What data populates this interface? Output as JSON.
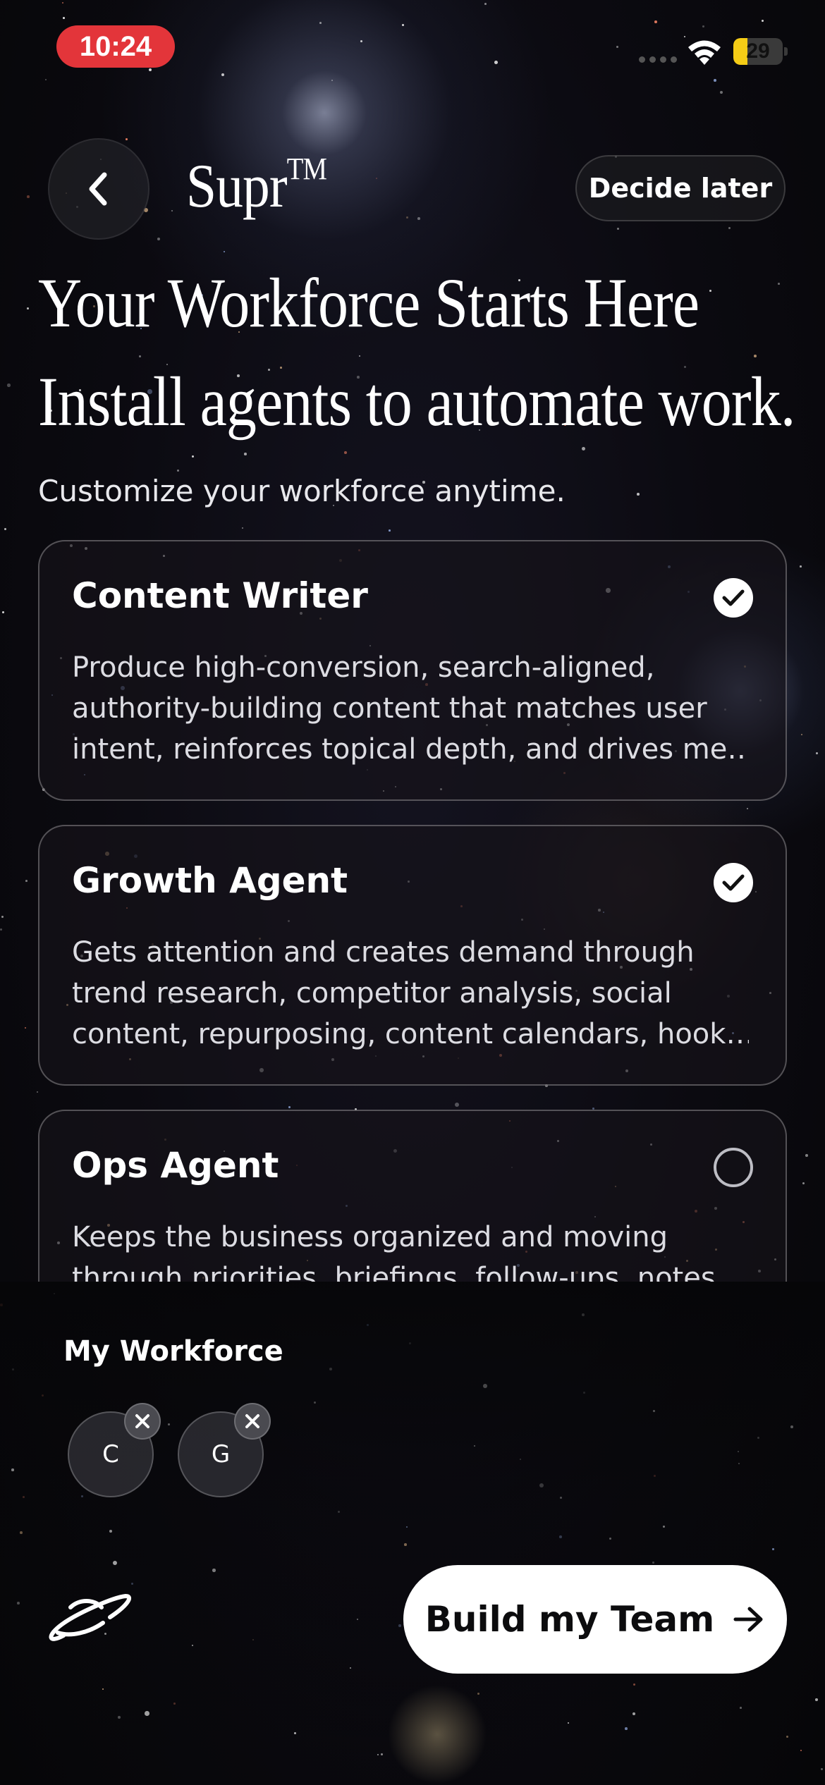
{
  "status_bar": {
    "time": "10:24",
    "battery_level": "29",
    "battery_fraction": 0.29,
    "battery_color": "#f5cc16",
    "time_pill_color": "#e3353a"
  },
  "header": {
    "brand": "Supr",
    "brand_mark": "TM",
    "decide_later_label": "Decide later",
    "back_icon": "chevron-left-icon"
  },
  "headline": {
    "line1": "Your Workforce Starts Here",
    "line2": "Install agents to automate work."
  },
  "subtext": "Customize your workforce anytime.",
  "agents": [
    {
      "name": "Content Writer",
      "selected": true,
      "description_lines": [
        "Produce high-conversion, search-aligned,",
        "authority-building content that matches user",
        "intent, reinforces topical depth, and drives me…"
      ]
    },
    {
      "name": "Growth Agent",
      "selected": true,
      "description_lines": [
        "Gets attention and creates demand through",
        "trend research, competitor analysis, social",
        "content, repurposing, content calendars, hook…"
      ]
    },
    {
      "name": "Ops Agent",
      "selected": false,
      "description_lines": [
        "Keeps the business organized and moving",
        "through priorities, briefings, follow-ups, notes,"
      ]
    }
  ],
  "workforce": {
    "title": "My Workforce",
    "members": [
      "C",
      "G"
    ]
  },
  "cta": {
    "label": "Build my Team",
    "icon": "arrow-right-icon"
  }
}
